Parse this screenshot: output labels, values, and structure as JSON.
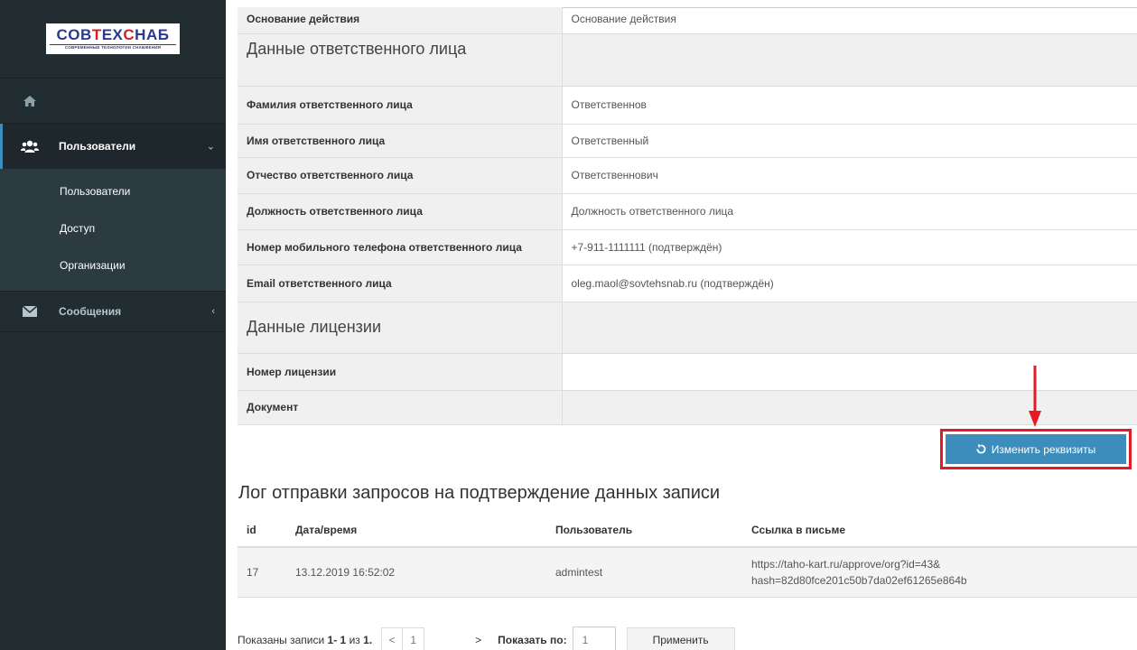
{
  "logo": {
    "brand_part1": "COB",
    "brand_t": "T",
    "brand_part2": "EX",
    "brand_c": "C",
    "brand_part3": "HAБ",
    "tagline": "СОВРЕМЕННЫЕ ТЕХНОЛОГИИ СНАБЖЕНИЯ"
  },
  "sidebar": {
    "home_icon": "home-icon",
    "users_section": {
      "label": "Пользователи",
      "icon": "users-icon",
      "caret": "⌄"
    },
    "submenu": [
      "Пользователи",
      "Доступ",
      "Организации"
    ],
    "messages_section": {
      "label": "Сообщения",
      "icon": "envelope-icon",
      "caret": "‹"
    }
  },
  "details": {
    "basis_key": "Основание действия",
    "basis_value": "Основание действия",
    "section_responsible": "Данные ответственного лица",
    "rows": [
      {
        "key": "Фамилия ответственного лица",
        "value": "Ответственнов"
      },
      {
        "key": "Имя ответственного лица",
        "value": "Ответственный"
      },
      {
        "key": "Отчество ответственного лица",
        "value": "Ответственнович"
      },
      {
        "key": "Должность ответственного лица",
        "value": "Должность ответственного лица"
      },
      {
        "key": "Номер мобильного телефона ответственного лица",
        "value": "+7-911-1111111 (подтверждён)"
      },
      {
        "key": "Email ответственного лица",
        "value": "oleg.maol@sovtehsnab.ru (подтверждён)"
      }
    ],
    "section_license": "Данные лицензии",
    "license_rows": [
      {
        "key": "Номер лицензии",
        "value": ""
      },
      {
        "key": "Документ",
        "value": ""
      }
    ]
  },
  "edit_button": {
    "label": "Изменить реквизиты",
    "icon": "undo-icon"
  },
  "annotation": {
    "color": "#e21b24"
  },
  "log": {
    "title": "Лог отправки запросов на подтверждение данных записи",
    "headers": [
      "id",
      "Дата/время",
      "Пользователь",
      "Ссылка в письме"
    ],
    "rows": [
      {
        "id": "17",
        "datetime": "13.12.2019 16:52:02",
        "user": "admintest",
        "link_line1": "https://taho-kart.ru/approve/org?id=43&",
        "link_line2": "hash=82d80fce201c50b7da02ef61265e864b"
      }
    ]
  },
  "pager": {
    "shown_prefix": "Показаны записи",
    "shown_range": "1- 1",
    "shown_of": "из",
    "shown_total": "1.",
    "prev": "<",
    "page": "1",
    "next": ">",
    "per_page_label": "Показать по:",
    "per_page_value": "1",
    "apply": "Применить"
  },
  "colors": {
    "sidebar_bg": "#222d32",
    "accent": "#3c8dbc",
    "highlight": "#e21b24"
  }
}
